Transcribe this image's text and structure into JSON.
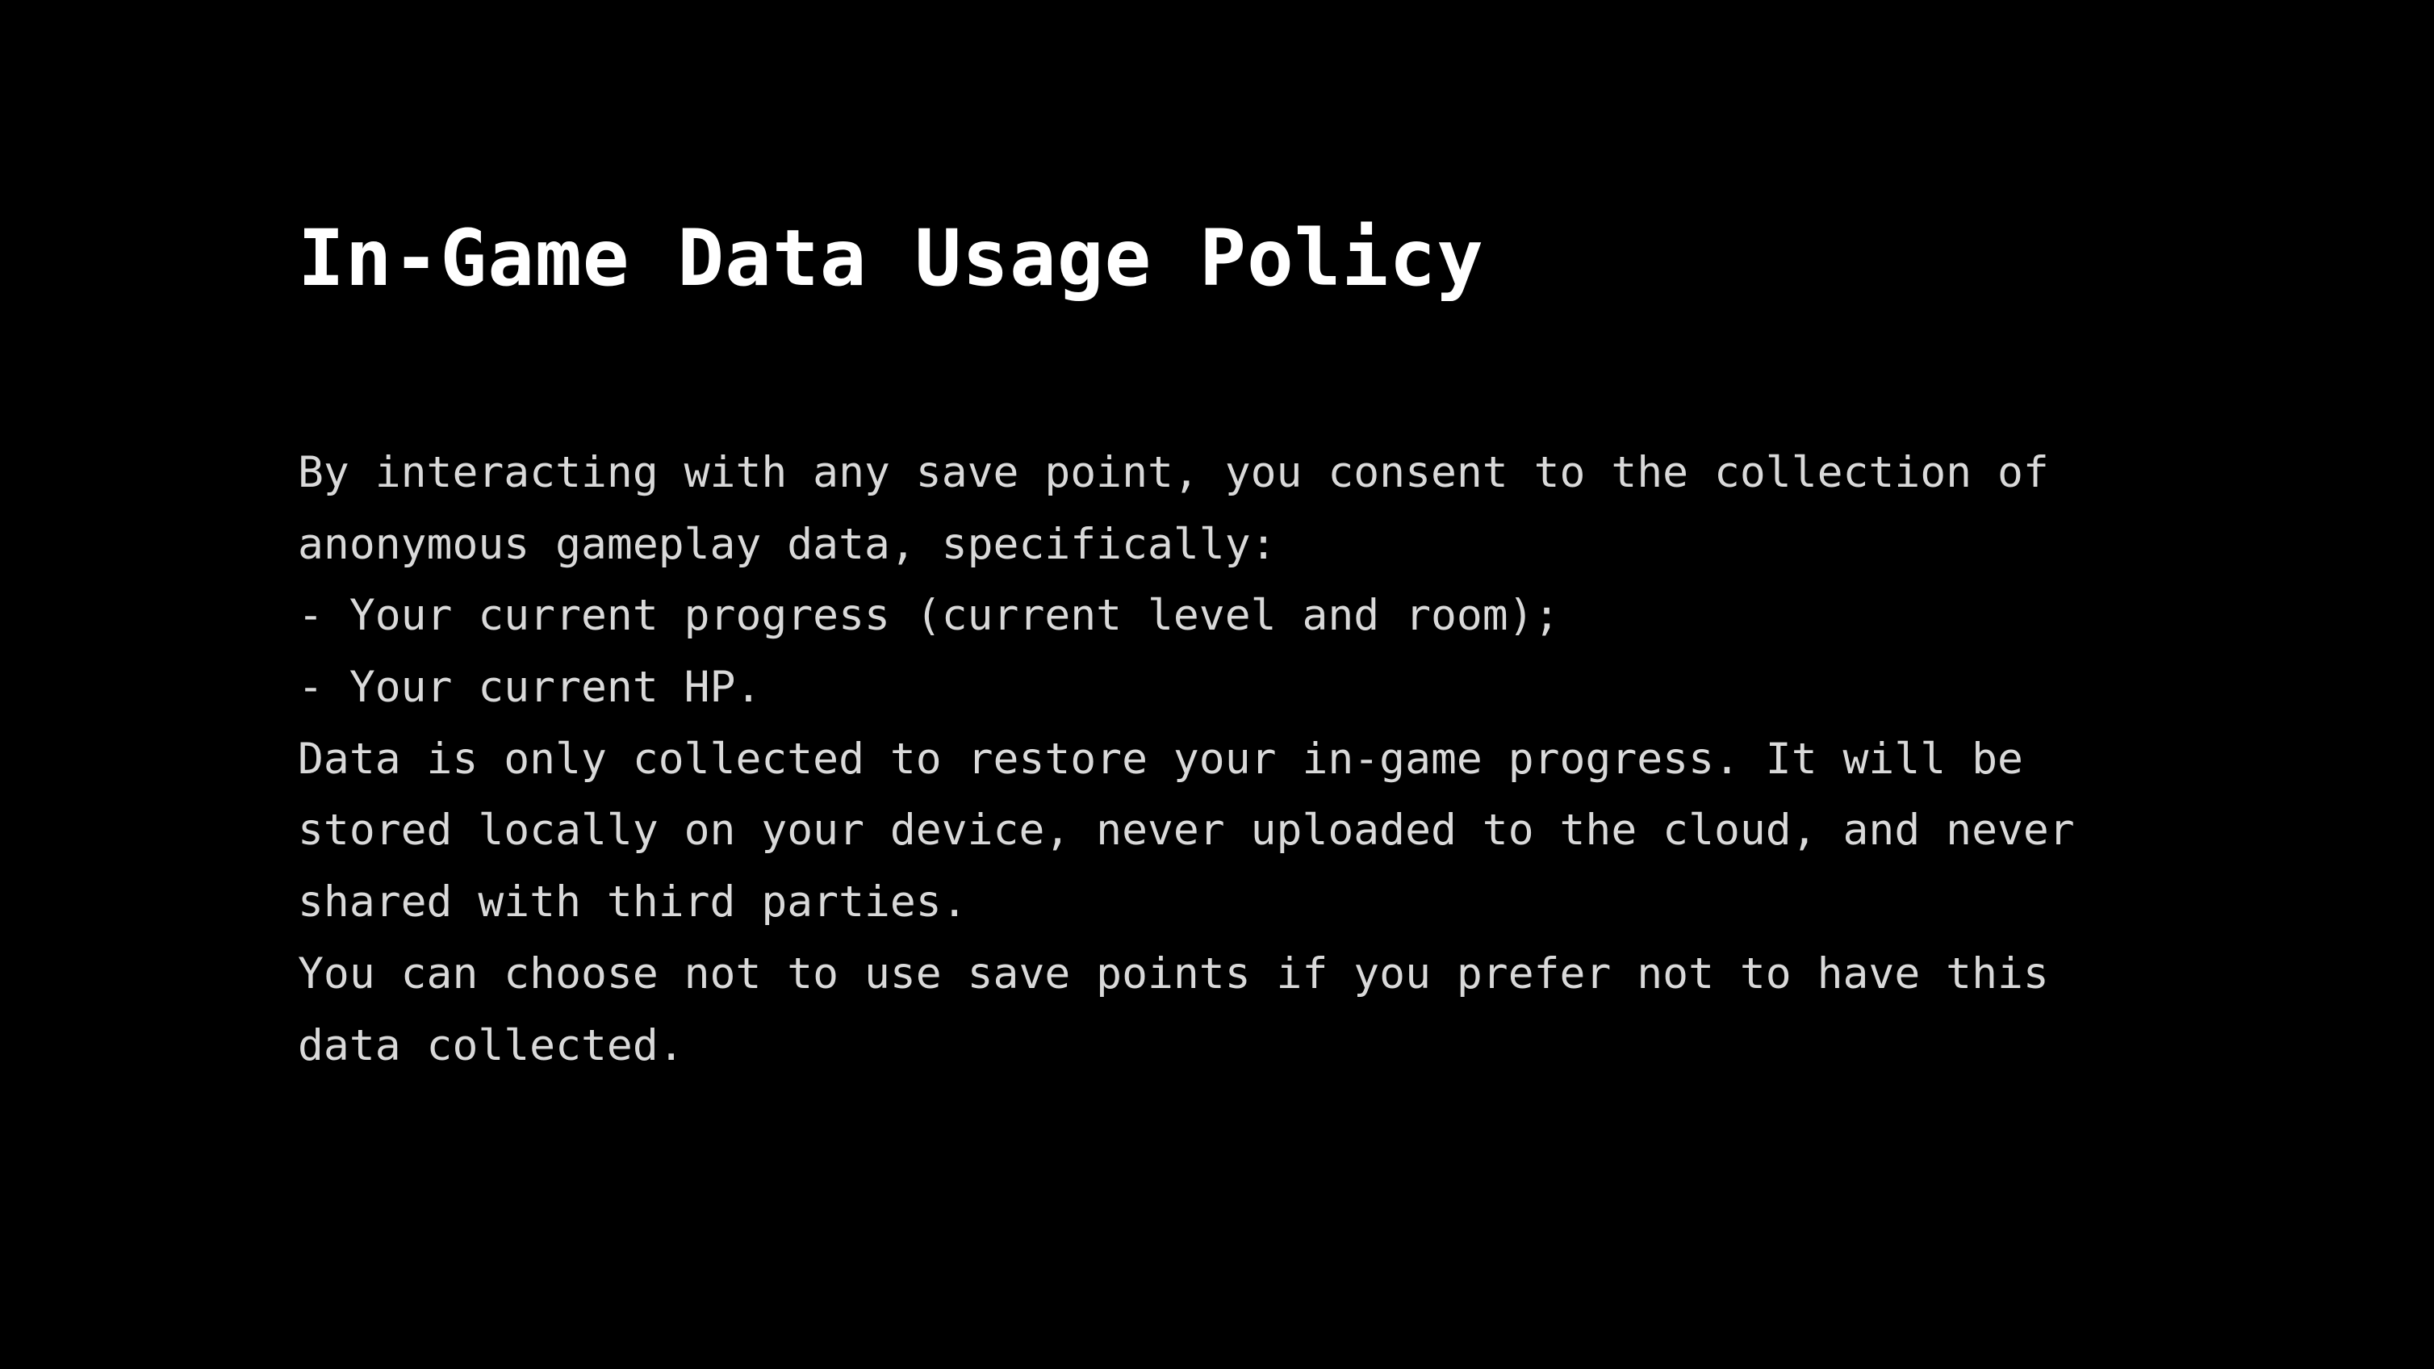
{
  "title": "In-Game Data Usage Policy",
  "body_lines": [
    "By interacting with any save point, you consent to the collection of",
    "anonymous gameplay data, specifically:",
    "- Your current progress (current level and room);",
    "- Your current HP.",
    "Data is only collected to restore your in-game progress. It will be",
    "stored locally on your device, never uploaded to the cloud, and never",
    "shared with third parties.",
    "You can choose not to use save points if you prefer not to have this",
    "data collected."
  ],
  "colors": {
    "background": "#000000",
    "title": "#ffffff",
    "body": "#d9d9d9"
  }
}
